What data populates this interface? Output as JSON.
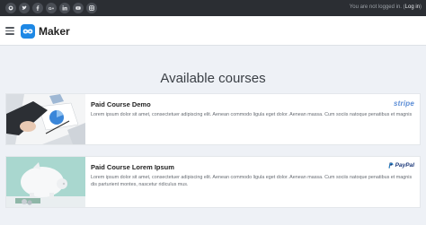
{
  "topbar": {
    "social_icons": [
      "github-icon",
      "twitter-icon",
      "facebook-icon",
      "google-plus-icon",
      "linkedin-icon",
      "youtube-icon",
      "instagram-icon"
    ],
    "status_text": "You are not logged in.",
    "open_paren": "(",
    "login_label": "Log in",
    "close_paren": ")"
  },
  "header": {
    "brand": "Maker",
    "menu_icon": "hamburger-icon",
    "logo_icon": "infinity-icon"
  },
  "main": {
    "title": "Available courses",
    "courses": [
      {
        "title": "Paid Course Demo",
        "description": "Lorem ipsum dolor sit amet, consectetuer adipiscing elit. Aenean commodo ligula eget dolor. Aenean massa. Cum sociis natoque penatibus et magnis",
        "gateway": "stripe"
      },
      {
        "title": "Paid Course Lorem Ipsum",
        "description": "Lorem ipsum dolor sit amet, consectetuer adipiscing elit. Aenean commodo ligula eget dolor. Aenean massa. Cum sociis natoque penatibus et magnis dis parturient montes, nascetur ridiculus mus.",
        "gateway": "PayPal"
      }
    ]
  },
  "colors": {
    "topbar_bg": "#2b2e33",
    "page_bg": "#eef1f6",
    "logo_blue": "#1e88e5",
    "stripe_blue": "#5b8dd6",
    "paypal_navy": "#1e3a7a"
  }
}
